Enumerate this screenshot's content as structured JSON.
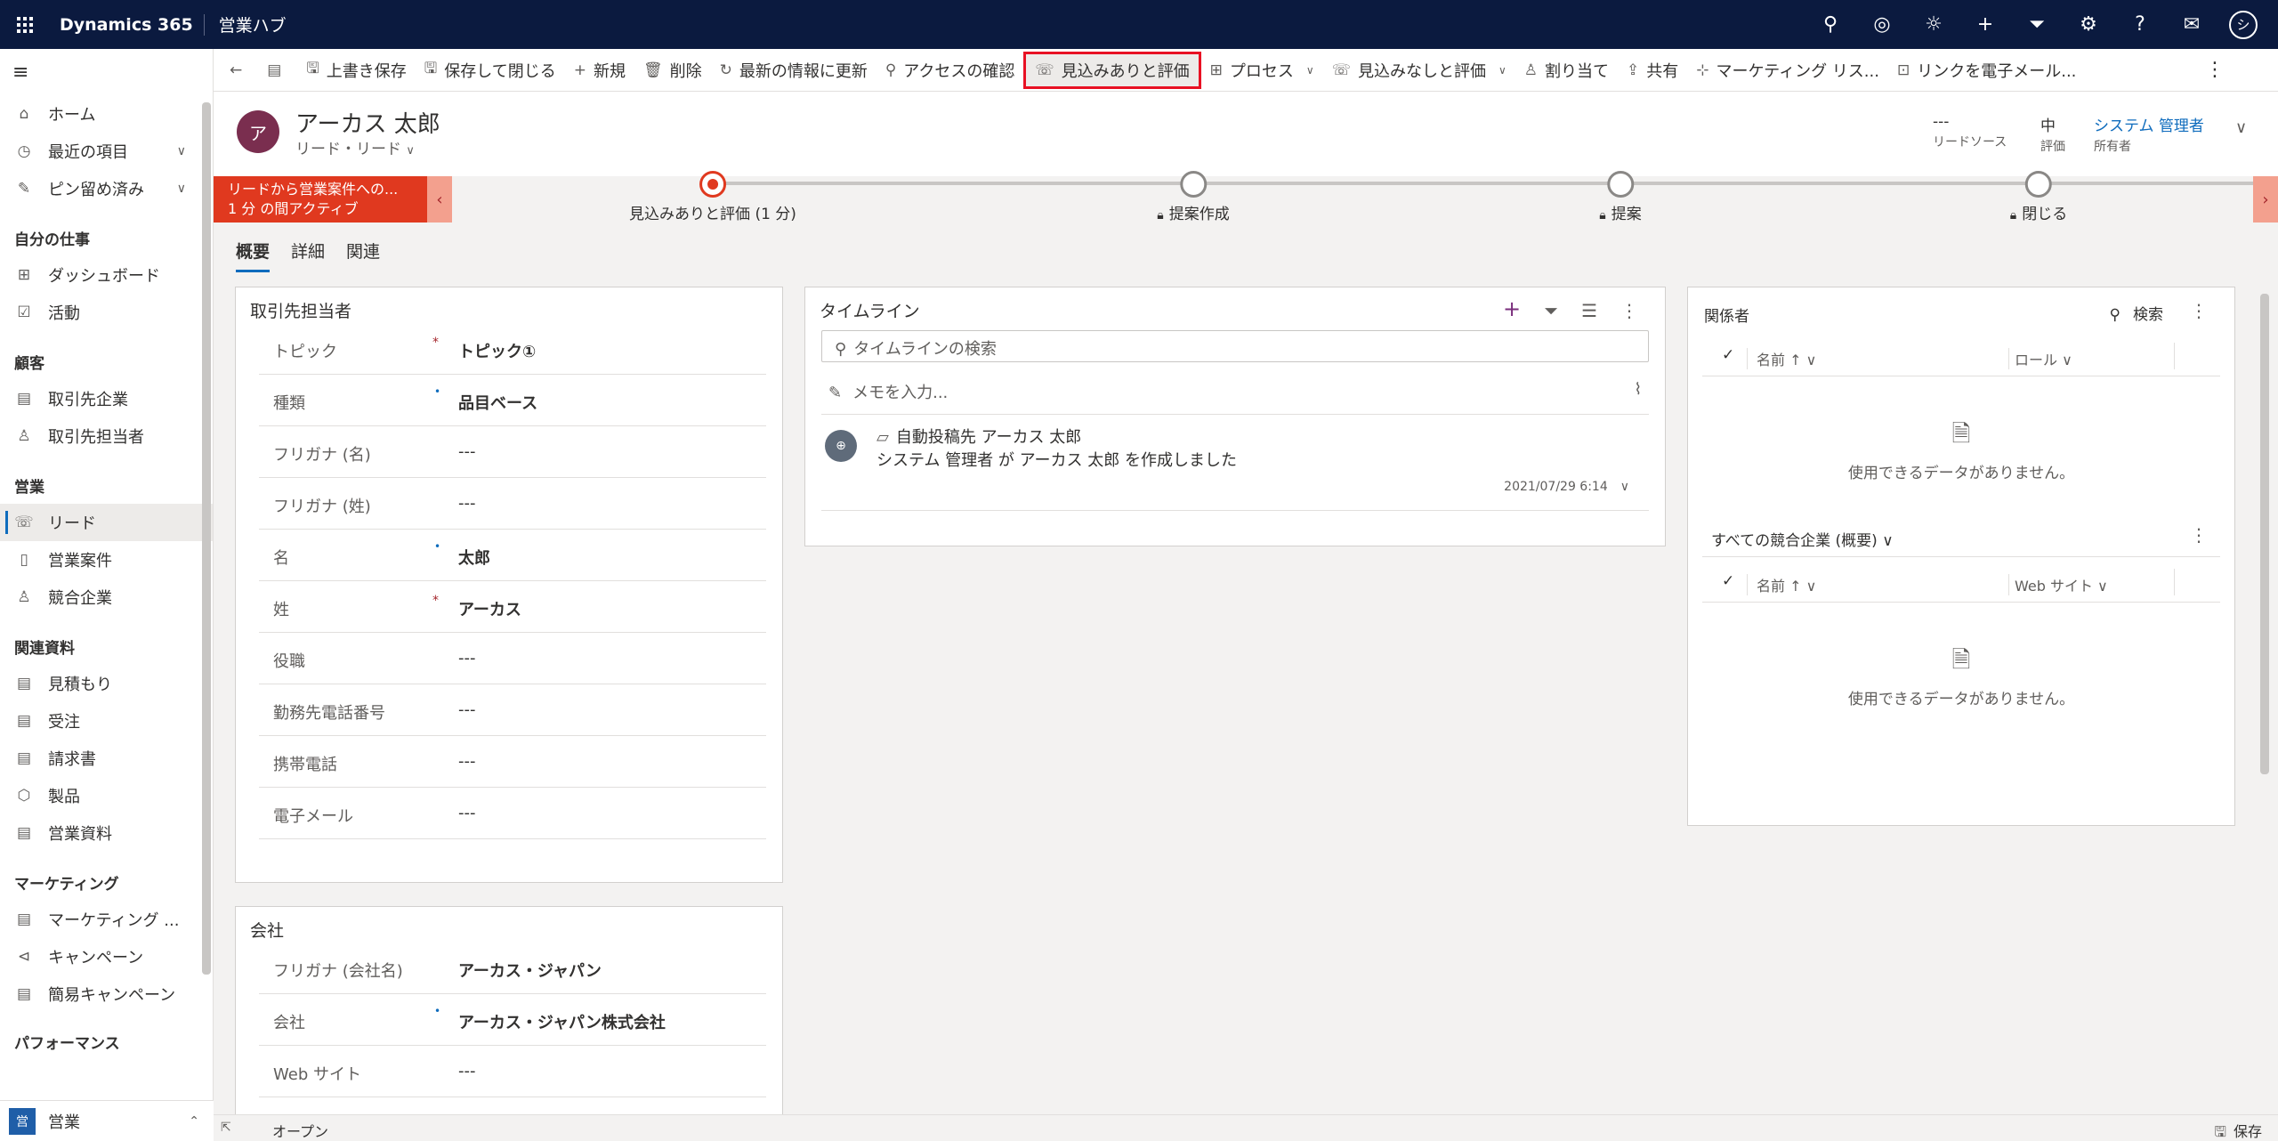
{
  "topbar": {
    "brand": "Dynamics 365",
    "app": "営業ハブ",
    "icons": [
      "search-icon",
      "target-icon",
      "lightbulb-icon",
      "plus-icon",
      "filter-icon",
      "gear-icon",
      "help-icon",
      "chat-icon"
    ],
    "avatar": "シ"
  },
  "sidebar": {
    "items_top": [
      {
        "icon": "⌂",
        "label": "ホーム"
      },
      {
        "icon": "◷",
        "label": "最近の項目",
        "chevron": "∨"
      },
      {
        "icon": "✎",
        "label": "ピン留め済み",
        "chevron": "∨"
      }
    ],
    "group_mywork": "自分の仕事",
    "mywork": [
      {
        "icon": "⊞",
        "label": "ダッシュボード"
      },
      {
        "icon": "☑",
        "label": "活動"
      }
    ],
    "group_customers": "顧客",
    "customers": [
      {
        "icon": "▤",
        "label": "取引先企業"
      },
      {
        "icon": "♙",
        "label": "取引先担当者"
      }
    ],
    "group_sales": "営業",
    "sales": [
      {
        "icon": "☏",
        "label": "リード"
      },
      {
        "icon": "▯",
        "label": "営業案件"
      },
      {
        "icon": "♙",
        "label": "競合企業"
      }
    ],
    "group_collateral": "関連資料",
    "collateral": [
      {
        "icon": "▤",
        "label": "見積もり"
      },
      {
        "icon": "▤",
        "label": "受注"
      },
      {
        "icon": "▤",
        "label": "請求書"
      },
      {
        "icon": "⬡",
        "label": "製品"
      },
      {
        "icon": "▤",
        "label": "営業資料"
      }
    ],
    "group_marketing": "マーケティング",
    "marketing": [
      {
        "icon": "▤",
        "label": "マーケティング ..."
      },
      {
        "icon": "⊲",
        "label": "キャンペーン"
      },
      {
        "icon": "▤",
        "label": "簡易キャンペーン"
      }
    ],
    "group_performance": "パフォーマンス",
    "area_badge": "営",
    "area_label": "営業"
  },
  "commands": [
    {
      "icon": "←",
      "label": ""
    },
    {
      "icon": "▤",
      "label": ""
    },
    {
      "icon": "🖫",
      "label": "上書き保存"
    },
    {
      "icon": "🖫",
      "label": "保存して閉じる"
    },
    {
      "icon": "+",
      "label": "新規"
    },
    {
      "icon": "🗑",
      "label": "削除"
    },
    {
      "icon": "↻",
      "label": "最新の情報に更新"
    },
    {
      "icon": "⚲",
      "label": "アクセスの確認"
    },
    {
      "icon": "☏",
      "label": "見込みありと評価"
    },
    {
      "icon": "⊞",
      "label": "プロセス",
      "dropdown": true
    },
    {
      "icon": "☏",
      "label": "見込みなしと評価",
      "dropdown": true
    },
    {
      "icon": "♙",
      "label": "割り当て"
    },
    {
      "icon": "⇪",
      "label": "共有"
    },
    {
      "icon": "⊹",
      "label": "マーケティング リス..."
    },
    {
      "icon": "⊡",
      "label": "リンクを電子メール..."
    }
  ],
  "more_icon": "⋮",
  "record": {
    "avatar": "ア",
    "name": "アーカス 太郎",
    "type": "リード・リード",
    "lead_source_value": "---",
    "lead_source_label": "リードソース",
    "rating_value": "中",
    "rating_label": "評価",
    "owner_value": "システム 管理者",
    "owner_label": "所有者"
  },
  "bpf": {
    "active_line1": "リードから営業案件への...",
    "active_line2": "1 分 の間アクティブ",
    "stages": [
      {
        "label": "見込みありと評価 (1 分)",
        "current": true
      },
      {
        "label": "提案作成",
        "locked": true
      },
      {
        "label": "提案",
        "locked": true
      },
      {
        "label": "閉じる",
        "locked": true
      }
    ]
  },
  "tabs": [
    "概要",
    "詳細",
    "関連"
  ],
  "contact_section": {
    "title": "取引先担当者",
    "fields": [
      {
        "label": "トピック",
        "value": "トピック①",
        "marker": "req"
      },
      {
        "label": "種類",
        "value": "品目ベース",
        "marker": "rec"
      },
      {
        "label": "フリガナ (名)",
        "value": "---"
      },
      {
        "label": "フリガナ (姓)",
        "value": "---"
      },
      {
        "label": "名",
        "value": "太郎",
        "marker": "rec"
      },
      {
        "label": "姓",
        "value": "アーカス",
        "marker": "req"
      },
      {
        "label": "役職",
        "value": "---"
      },
      {
        "label": "勤務先電話番号",
        "value": "---"
      },
      {
        "label": "携帯電話",
        "value": "---"
      },
      {
        "label": "電子メール",
        "value": "---"
      }
    ]
  },
  "company_section": {
    "title": "会社",
    "fields": [
      {
        "label": "フリガナ (会社名)",
        "value": "アーカス・ジャパン"
      },
      {
        "label": "会社",
        "value": "アーカス・ジャパン株式会社",
        "marker": "rec"
      },
      {
        "label": "Web サイト",
        "value": "---"
      }
    ]
  },
  "timeline": {
    "title": "タイムライン",
    "search_placeholder": "タイムラインの検索",
    "note_placeholder": "メモを入力...",
    "entry_title": "自動投稿先 アーカス 太郎",
    "entry_body": "システム 管理者 が アーカス 太郎 を作成しました",
    "entry_date": "2021/07/29 6:14"
  },
  "stakeholders": {
    "title": "関係者",
    "search": "検索",
    "col1": "名前 ↑ ∨",
    "col2": "ロール ∨",
    "empty": "使用できるデータがありません。"
  },
  "competitors": {
    "title": "すべての競合企業 (概要) ∨",
    "col1": "名前 ↑ ∨",
    "col2": "Web サイト ∨",
    "empty": "使用できるデータがありません。"
  },
  "status": {
    "state": "オープン",
    "save": "保存"
  }
}
